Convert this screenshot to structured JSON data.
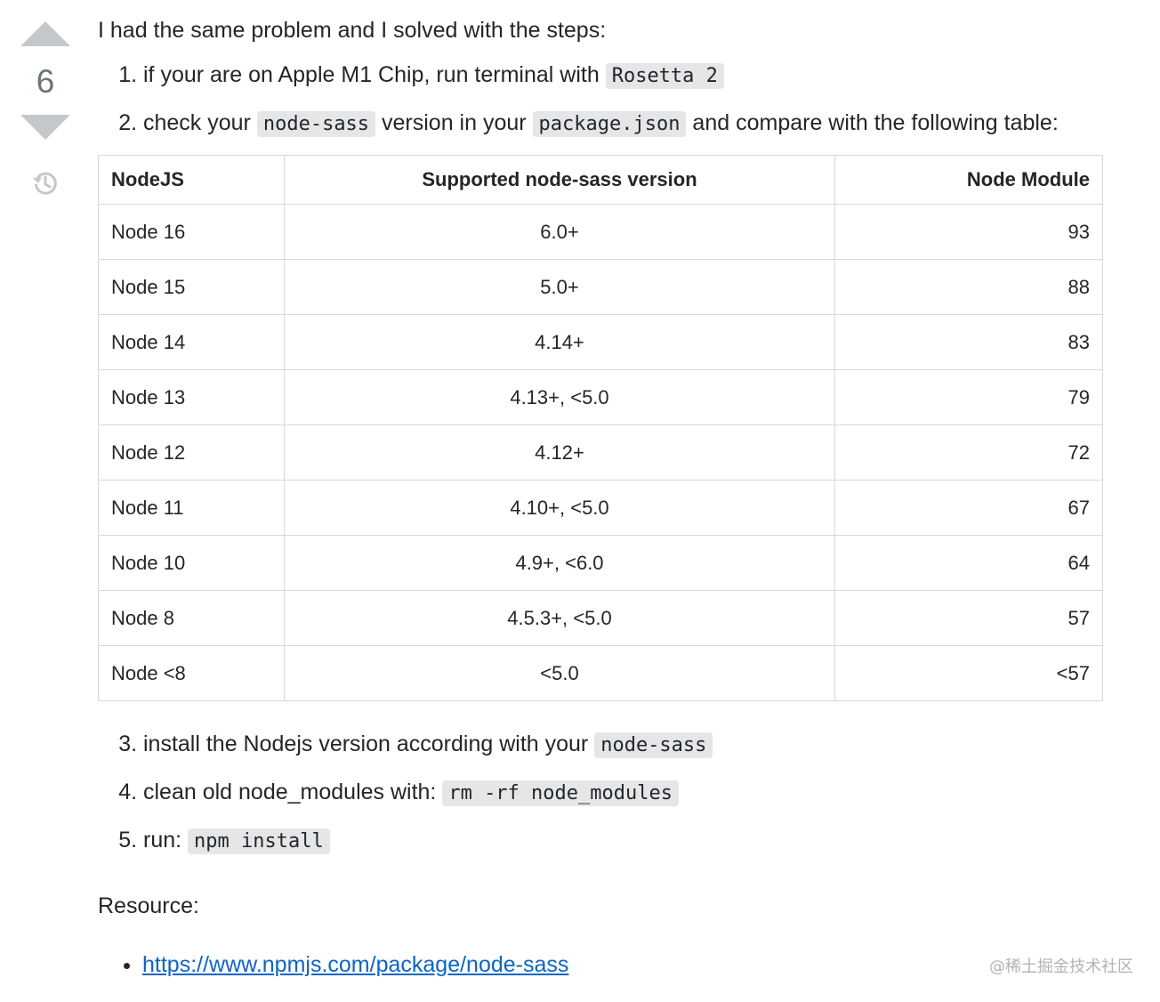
{
  "vote": {
    "count": "6"
  },
  "post": {
    "intro": "I had the same problem and I solved with the steps:",
    "steps_a": [
      {
        "text": "if your are on Apple M1 Chip, run terminal with ",
        "code": "Rosetta 2"
      },
      {
        "text": "check your ",
        "code": "node-sass",
        "text2": " version in your ",
        "code2": "package.json",
        "text3": " and compare with the following table:"
      }
    ],
    "table": {
      "headers": [
        "NodeJS",
        "Supported node-sass version",
        "Node Module"
      ],
      "rows": [
        [
          "Node 16",
          "6.0+",
          "93"
        ],
        [
          "Node 15",
          "5.0+",
          "88"
        ],
        [
          "Node 14",
          "4.14+",
          "83"
        ],
        [
          "Node 13",
          "4.13+, <5.0",
          "79"
        ],
        [
          "Node 12",
          "4.12+",
          "72"
        ],
        [
          "Node 11",
          "4.10+, <5.0",
          "67"
        ],
        [
          "Node 10",
          "4.9+, <6.0",
          "64"
        ],
        [
          "Node 8",
          "4.5.3+, <5.0",
          "57"
        ],
        [
          "Node <8",
          "<5.0",
          "<57"
        ]
      ]
    },
    "steps_b": [
      {
        "text": "install the Nodejs version according with your ",
        "code": "node-sass"
      },
      {
        "text": "clean old node_modules with: ",
        "code": "rm -rf node_modules"
      },
      {
        "text": "run: ",
        "code": "npm install"
      }
    ],
    "resource_label": "Resource:",
    "links": [
      "https://www.npmjs.com/package/node-sass"
    ]
  },
  "watermark": "@稀土掘金技术社区"
}
